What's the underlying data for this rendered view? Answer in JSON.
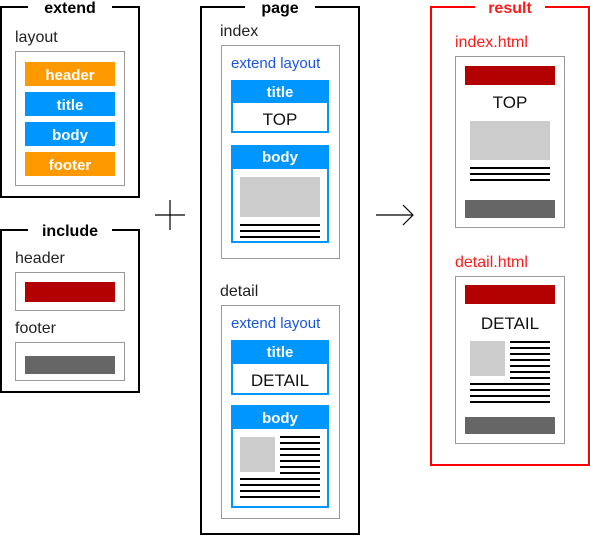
{
  "colors": {
    "orange": "#ff9900",
    "blue": "#0096ff",
    "red_bar": "#b30000",
    "gray_bar": "#666666",
    "image": "#cccccc",
    "result_border": "#ff0000",
    "text_link": "#1a55e0"
  },
  "extend": {
    "title": "extend",
    "layout_label": "layout",
    "slots": [
      "header",
      "title",
      "body",
      "footer"
    ]
  },
  "include": {
    "title": "include",
    "header_label": "header",
    "footer_label": "footer"
  },
  "operator_plus": "+",
  "page": {
    "title": "page",
    "index": {
      "label": "index",
      "extend_text": "extend layout",
      "title_slot": "title",
      "title_value": "TOP",
      "body_slot": "body"
    },
    "detail": {
      "label": "detail",
      "extend_text": "extend layout",
      "title_slot": "title",
      "title_value": "DETAIL",
      "body_slot": "body"
    }
  },
  "operator_arrow": "→",
  "result": {
    "title": "result",
    "index": {
      "filename": "index.html",
      "title_value": "TOP"
    },
    "detail": {
      "filename": "detail.html",
      "title_value": "DETAIL"
    }
  }
}
